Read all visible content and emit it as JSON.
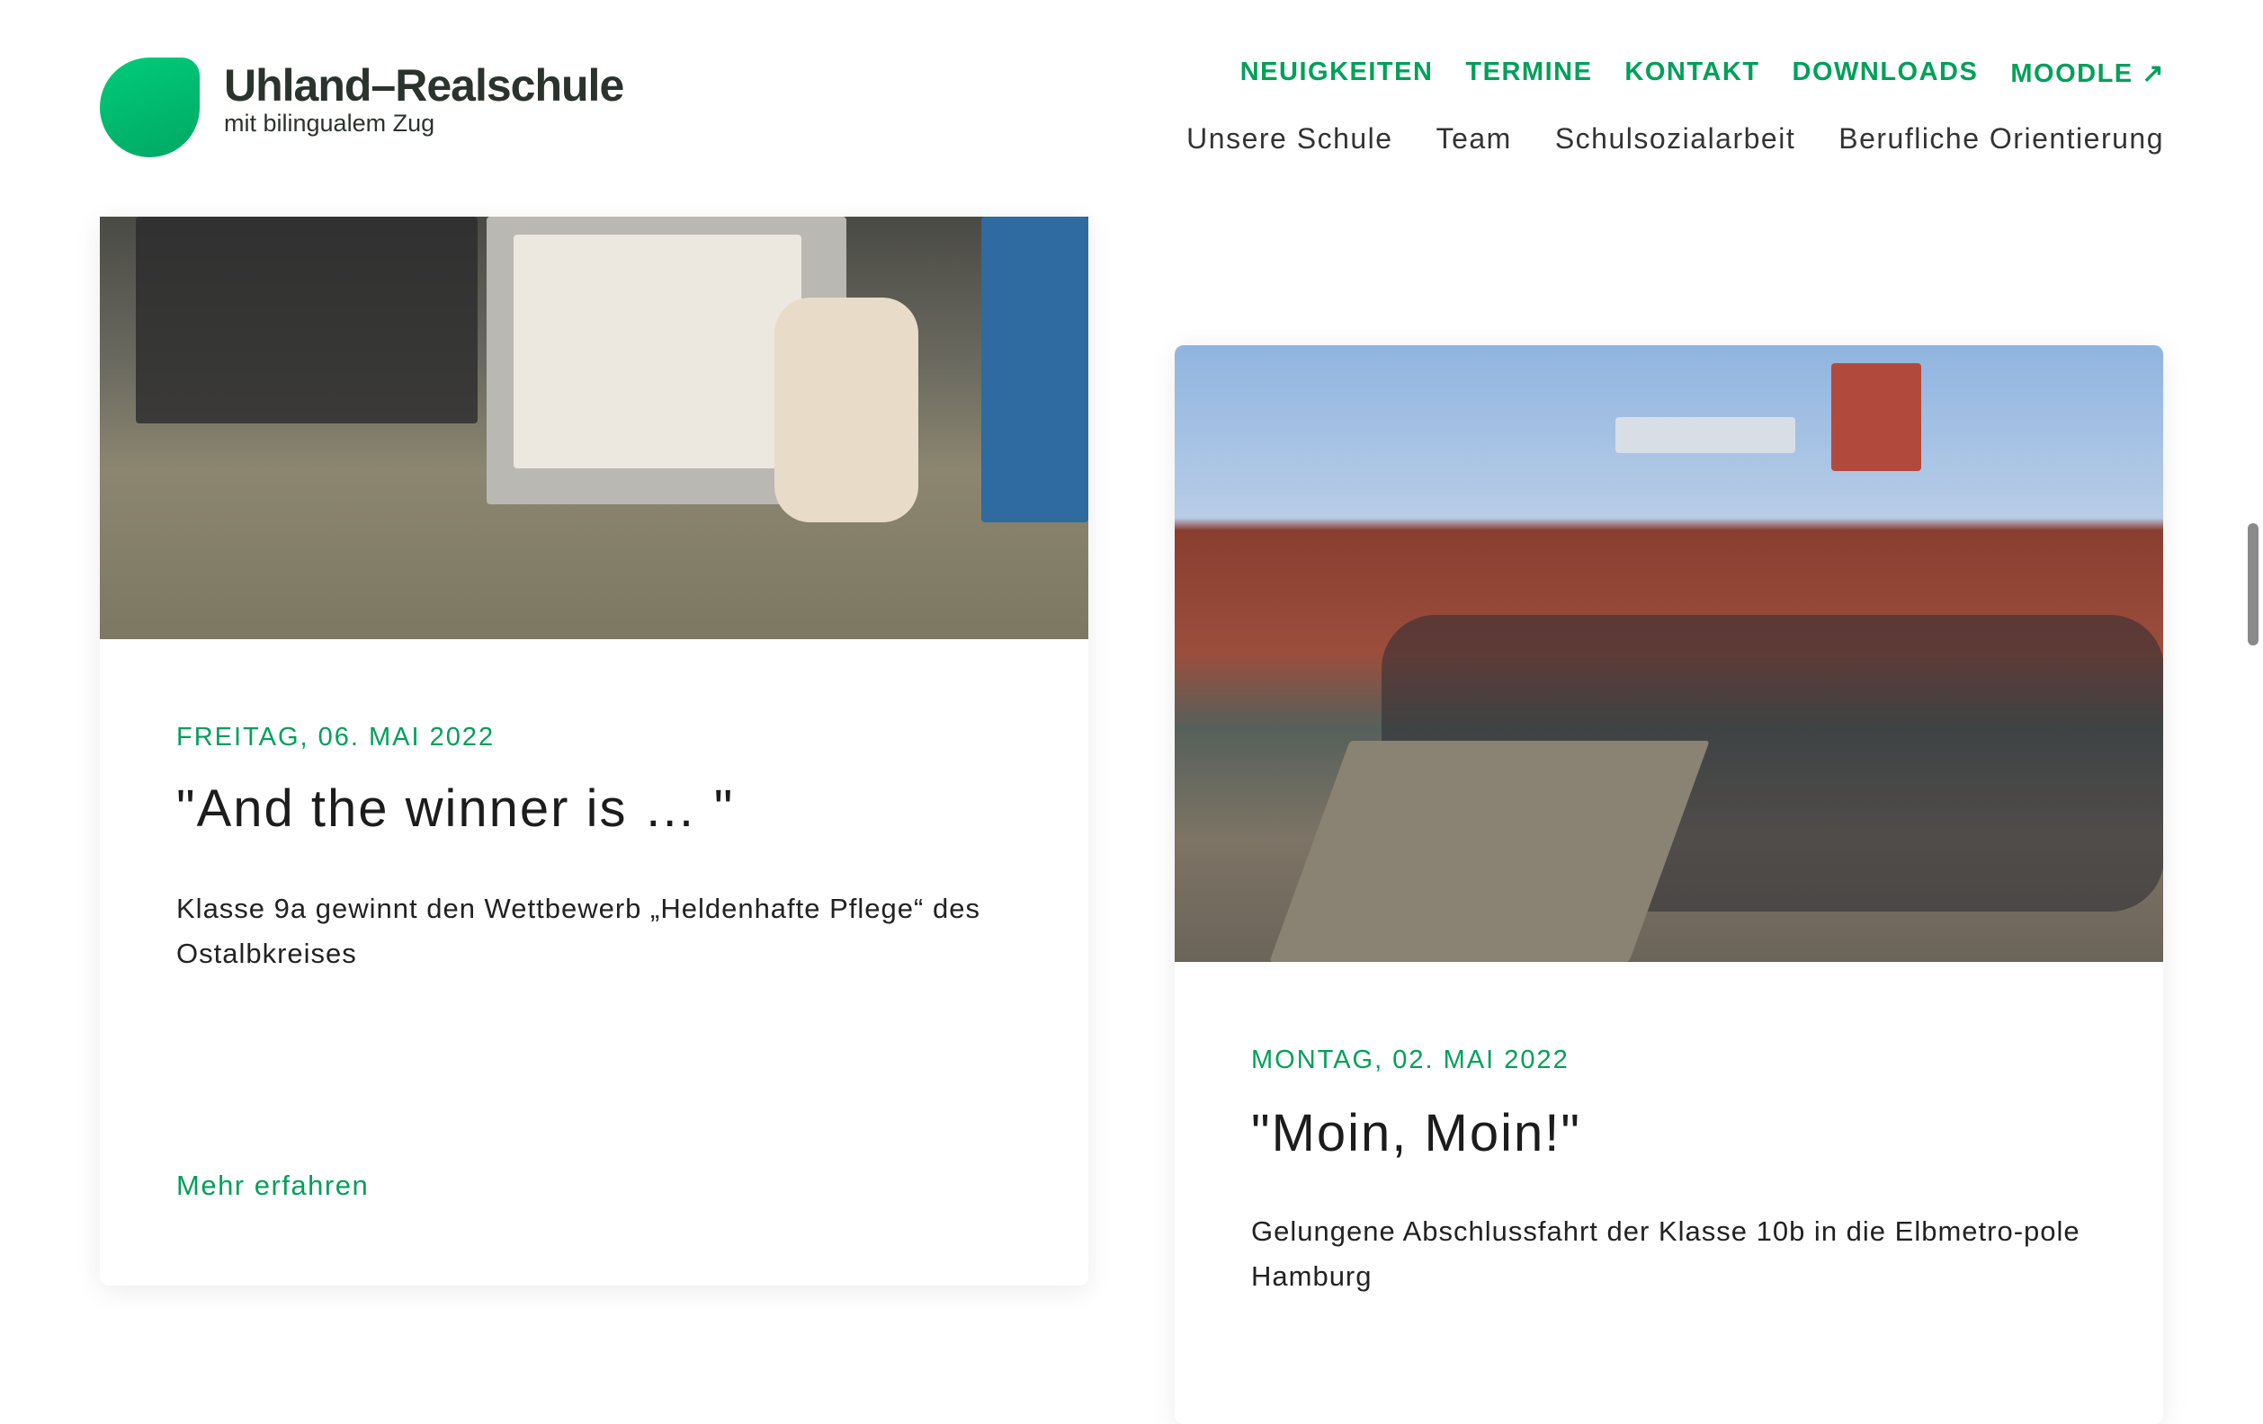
{
  "header": {
    "brand_title": "Uhland–Realschule",
    "brand_subtitle": "mit bilingualem Zug",
    "brand_color": "#00b36b",
    "top_nav": [
      "NEUIGKEITEN",
      "TERMINE",
      "KONTAKT",
      "DOWNLOADS",
      "MOODLE ↗"
    ],
    "sub_nav": [
      "Unsere Schule",
      "Team",
      "Schulsozialarbeit",
      "Berufliche Orientierung"
    ]
  },
  "cards": [
    {
      "date": "FREITAG, 06. MAI 2022",
      "title": "\"And the winner is … \"",
      "description": "Klasse 9a gewinnt den Wettbewerb „Heldenhafte Pflege“ des Ostalbkreises",
      "link": "Mehr erfahren"
    },
    {
      "date": "MONTAG, 02. MAI 2022",
      "title": "\"Moin, Moin!\"",
      "description": "Gelungene Abschlussfahrt der Klasse 10b in die Elbmetro-pole Hamburg"
    }
  ],
  "accent_color": "#00a05a"
}
